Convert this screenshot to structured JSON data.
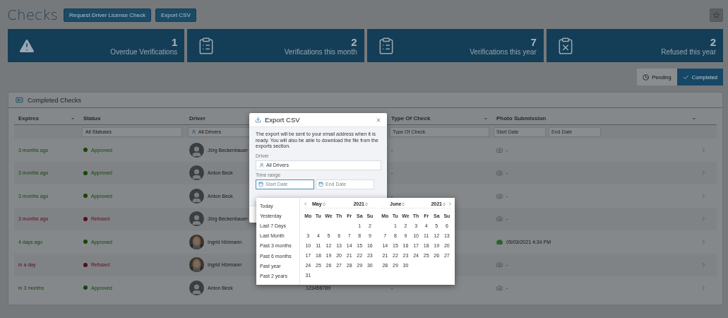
{
  "page": {
    "title": "Checks",
    "buttons": [
      "Request Driver License Check",
      "Export CSV"
    ]
  },
  "stats": [
    {
      "kind": "warning",
      "value": "1",
      "label": "Overdue Verifications"
    },
    {
      "kind": "clipboard",
      "value": "2",
      "label": "Verifications this month"
    },
    {
      "kind": "clipboard",
      "value": "7",
      "label": "Verifications this year"
    },
    {
      "kind": "refused",
      "value": "2",
      "label": "Refused this year"
    }
  ],
  "view_toggle": [
    {
      "kind": "pending",
      "label": "Pending",
      "selected": false
    },
    {
      "kind": "completed",
      "label": "Completed",
      "selected": true
    }
  ],
  "panel": {
    "title": "Completed Checks",
    "columns": [
      {
        "label": "Expires",
        "sortable": true
      },
      {
        "label": "Status",
        "sortable": false
      },
      {
        "label": "Driver"
      },
      {
        "label": "Type Of Check",
        "sortable": true
      },
      {
        "label": "Photo Submission",
        "sortable": true
      }
    ],
    "filters": {
      "status": "All Statuses",
      "driver": "All Drivers",
      "type_placeholder": "Type Of Check",
      "start_placeholder": "Start Date",
      "end_placeholder": "End Date"
    },
    "rows": [
      {
        "expires": "3 months ago",
        "status": {
          "text": "Approved",
          "color": "#14470c"
        },
        "driver": {
          "name": "Jörg Beckenbauer",
          "kind": "placeholder"
        },
        "type_of_check": "-",
        "photo": {
          "submitted": false,
          "text": "-"
        }
      },
      {
        "expires": "3 months ago",
        "status": {
          "text": "Approved",
          "color": "#14470c"
        },
        "driver": {
          "name": "Anton Beck",
          "kind": "placeholder"
        },
        "type_of_check": "-",
        "photo": {
          "submitted": false,
          "text": "-"
        }
      },
      {
        "expires": "3 months ago",
        "status": {
          "text": "Approved",
          "color": "#14470c"
        },
        "driver": {
          "name": "Anton Beck",
          "kind": "placeholder"
        },
        "type_of_check": "-",
        "photo": {
          "submitted": false,
          "text": "-"
        }
      },
      {
        "expires": "3 months ago",
        "status": {
          "text": "Refused",
          "color": "#5c0a1a"
        },
        "driver": {
          "name": "Jörg Beckenbauer",
          "kind": "placeholder"
        },
        "photo": {
          "submitted": false,
          "text": "-"
        }
      },
      {
        "expires": "4 days ago",
        "status": {
          "text": "Approved",
          "color": "#14470c"
        },
        "driver": {
          "name": "Ingrid Hörmann",
          "kind": "picture"
        },
        "photo": {
          "submitted": true,
          "text": "05/03/2021 4:34 PM"
        }
      },
      {
        "expires": "in a day",
        "status": {
          "text": "Refused",
          "color": "#5c0a1a"
        },
        "driver": {
          "name": "Ingrid Hörmann",
          "kind": "picture"
        },
        "photo": {
          "submitted": false,
          "text": "-"
        }
      },
      {
        "expires": "in 3 months",
        "status": {
          "text": "Approved",
          "color": "#14470c"
        },
        "driver": {
          "name": "Anton Beck",
          "kind": "placeholder"
        },
        "column_4": "123456789",
        "type_of_check": "-",
        "photo": {
          "submitted": false,
          "text": "-"
        }
      }
    ]
  },
  "modal": {
    "title": "Export CSV",
    "description": "The export will be sent to your email address when it is ready. You will also be able to download the file from the exports section.",
    "driver_label": "Driver",
    "driver_value": "All Drivers",
    "time_label": "Time range",
    "start_placeholder": "Start Date",
    "end_placeholder": "End Date",
    "start_focused": true
  },
  "date_picker": {
    "presets": [
      "Today",
      "Yesterday",
      "Last 7 Days",
      "Last Month",
      "Past 3 months",
      "Past 6 months",
      "Past year",
      "Past 2 years"
    ],
    "months": [
      {
        "month": "May",
        "year": "2021",
        "weekdays": [
          "Mo",
          "Tu",
          "We",
          "Th",
          "Fr",
          "Sa",
          "Su"
        ],
        "weeks": [
          [
            "1",
            "2"
          ],
          [
            "3",
            "4",
            "5",
            "6",
            "7",
            "8",
            "9"
          ],
          [
            "10",
            "11",
            "12",
            "13",
            "14",
            "15",
            "16"
          ],
          [
            "17",
            "18",
            "19",
            "20",
            "21",
            "22",
            "23"
          ],
          [
            "24",
            "25",
            "26",
            "27",
            "28",
            "29",
            "30"
          ],
          [
            "31"
          ]
        ]
      },
      {
        "month": "June",
        "year": "2021",
        "weekdays": [
          "Mo",
          "Tu",
          "We",
          "Th",
          "Fr",
          "Sa",
          "Su"
        ],
        "weeks": [
          [
            "1",
            "2",
            "3",
            "4",
            "5",
            "6"
          ],
          [
            "7",
            "8",
            "9",
            "10",
            "11",
            "12",
            "13"
          ],
          [
            "14",
            "15",
            "16",
            "17",
            "18",
            "19",
            "20"
          ],
          [
            "21",
            "22",
            "23",
            "24",
            "25",
            "26",
            "27"
          ],
          [
            "28",
            "29",
            "30"
          ]
        ]
      }
    ]
  }
}
